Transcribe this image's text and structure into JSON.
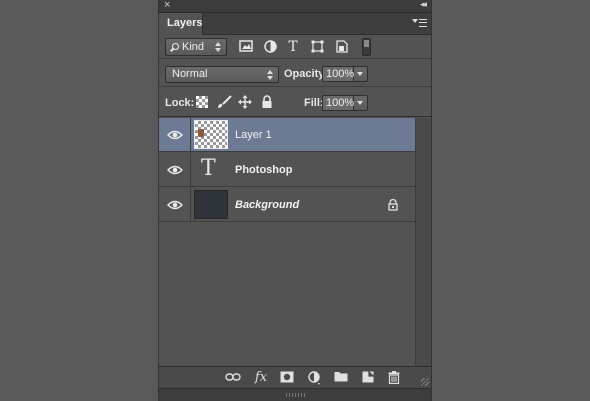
{
  "panel": {
    "tab_label": "Layers",
    "close_glyph": "×",
    "collapse_glyph": "◂◂"
  },
  "filter": {
    "kind_label": "Kind",
    "icons": [
      "image-filter-icon",
      "adjustment-filter-icon",
      "type-filter-icon",
      "shape-filter-icon",
      "smart-object-filter-icon"
    ],
    "type_glyph": "T"
  },
  "blend": {
    "mode": "Normal",
    "opacity_label": "Opacity:",
    "opacity_value": "100%"
  },
  "lock": {
    "label": "Lock:",
    "fill_label": "Fill:",
    "fill_value": "100%"
  },
  "layers": [
    {
      "name": "Layer 1",
      "selected": true,
      "visible": true,
      "type": "pixel"
    },
    {
      "name": "Photoshop",
      "selected": false,
      "visible": true,
      "type": "text",
      "glyph": "T"
    },
    {
      "name": "Background",
      "selected": false,
      "visible": true,
      "type": "background",
      "locked": true
    }
  ],
  "bottom": {
    "fx_label": "fx"
  },
  "colors": {
    "selection": "#6c7b93",
    "panel_bg": "#535353",
    "page_bg": "#595959"
  }
}
